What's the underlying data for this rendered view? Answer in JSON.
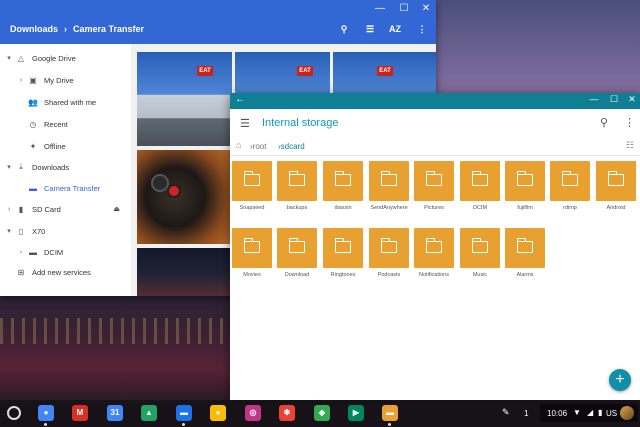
{
  "files_app": {
    "breadcrumb": [
      "Downloads",
      "Camera Transfer"
    ],
    "sort_label": "AZ",
    "sidebar": [
      {
        "label": "Google Drive",
        "icon": "drive-icon",
        "expander": "down",
        "indent": 0
      },
      {
        "label": "My Drive",
        "icon": "folder-drive-icon",
        "expander": "right",
        "indent": 1
      },
      {
        "label": "Shared with me",
        "icon": "people-icon",
        "expander": "",
        "indent": 1
      },
      {
        "label": "Recent",
        "icon": "clock-icon",
        "expander": "",
        "indent": 1
      },
      {
        "label": "Offline",
        "icon": "pin-icon",
        "expander": "",
        "indent": 1
      },
      {
        "label": "Downloads",
        "icon": "download-icon",
        "expander": "down",
        "indent": 0
      },
      {
        "label": "Camera Transfer",
        "icon": "folder-icon",
        "expander": "",
        "indent": 1,
        "active": true
      },
      {
        "label": "SD Card",
        "icon": "sd-card-icon",
        "expander": "right",
        "indent": 0,
        "eject": true
      },
      {
        "label": "X70",
        "icon": "phone-icon",
        "expander": "down",
        "indent": 0
      },
      {
        "label": "DCIM",
        "icon": "folder-icon",
        "expander": "right",
        "indent": 1
      },
      {
        "label": "Add new services",
        "icon": "plus-box-icon",
        "expander": "",
        "indent": 0
      }
    ],
    "sign_text": "EAT"
  },
  "solid_explorer": {
    "title": "Internal storage",
    "path": [
      "root",
      "sdcard"
    ],
    "folders": [
      "Snapseed",
      "backups",
      "diaxxin",
      "SendAnywhere",
      "Pictures",
      "DCIM",
      "fujifilm",
      "rdimp",
      "Android",
      "Movies",
      "Download",
      "Ringtones",
      "Podcasts",
      "Notifications",
      "Music",
      "Alarms"
    ],
    "fab_label": "+",
    "accent_color": "#0f7f95",
    "folder_color": "#e8a030"
  },
  "shelf": {
    "apps": [
      {
        "name": "chrome-icon",
        "color": "#4285f4",
        "glyph": "●"
      },
      {
        "name": "gmail-icon",
        "color": "#d93025",
        "glyph": "M"
      },
      {
        "name": "calendar-icon",
        "color": "#4285f4",
        "glyph": "31"
      },
      {
        "name": "google-drive-icon",
        "color": "#1fa463",
        "glyph": "▲"
      },
      {
        "name": "files-icon",
        "color": "#1a73e8",
        "glyph": "▬"
      },
      {
        "name": "keep-icon",
        "color": "#fbbc04",
        "glyph": "●"
      },
      {
        "name": "instagram-icon",
        "color": "#c13584",
        "glyph": "◎"
      },
      {
        "name": "photos-icon",
        "color": "#ea4335",
        "glyph": "✱"
      },
      {
        "name": "snapseed-icon",
        "color": "#34a853",
        "glyph": "◆"
      },
      {
        "name": "play-store-icon",
        "color": "#01875f",
        "glyph": "▶"
      },
      {
        "name": "solid-explorer-icon",
        "color": "#e8a030",
        "glyph": "▬"
      }
    ],
    "desk_number": "1",
    "time": "10:06",
    "language": "US"
  }
}
